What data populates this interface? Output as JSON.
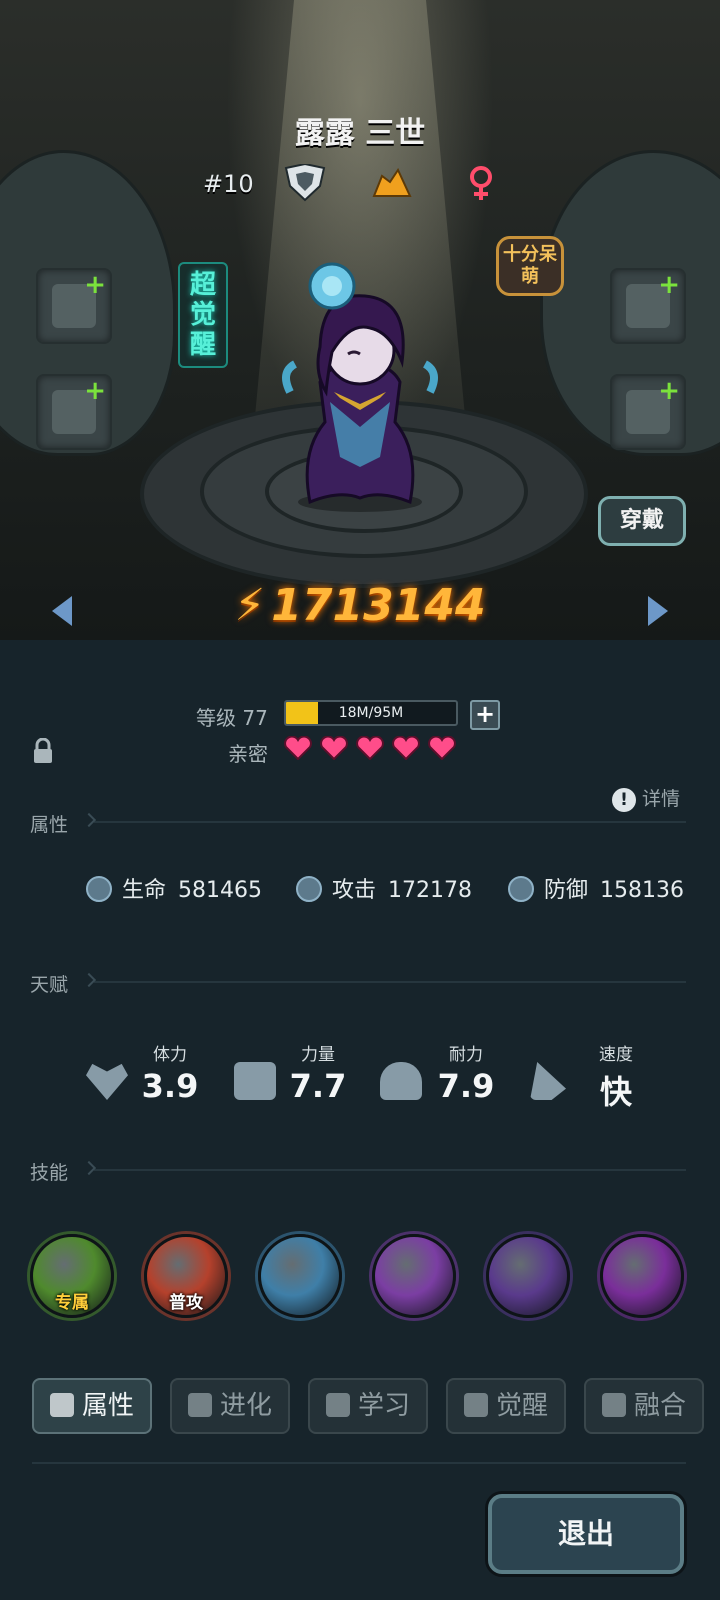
{
  "hero": {
    "name": "露露 三世",
    "rank": "#10",
    "awaken_badge": "超觉醒",
    "trait_badge": "十分呆萌",
    "equip_button": "穿戴",
    "power": "1713144"
  },
  "progress": {
    "level_label": "等级 77",
    "exp_text": "18M/95M",
    "exp_fraction": 0.19,
    "intimacy_label": "亲密",
    "hearts": 5
  },
  "sections": {
    "attributes": "属性",
    "details": "详情",
    "talent": "天赋",
    "skills": "技能"
  },
  "stats": [
    {
      "label": "生命",
      "value": "581465",
      "icon": "heart-shield-icon"
    },
    {
      "label": "攻击",
      "value": "172178",
      "icon": "sword-icon"
    },
    {
      "label": "防御",
      "value": "158136",
      "icon": "shield-icon"
    }
  ],
  "talents": [
    {
      "label": "体力",
      "value": "3.9",
      "icon": "heart-icon"
    },
    {
      "label": "力量",
      "value": "7.7",
      "icon": "fist-icon"
    },
    {
      "label": "耐力",
      "value": "7.9",
      "icon": "muscle-icon"
    },
    {
      "label": "速度",
      "value": "快",
      "icon": "wing-icon"
    }
  ],
  "skills": [
    {
      "tag": "专属",
      "color": "#4f8a2d"
    },
    {
      "tag": "普攻",
      "color": "#b5412c"
    },
    {
      "tag": "",
      "color": "#3f7fa8"
    },
    {
      "tag": "",
      "color": "#7b3ea3"
    },
    {
      "tag": "",
      "color": "#5a3a8c"
    },
    {
      "tag": "",
      "color": "#7a2e9a"
    }
  ],
  "tabs": [
    {
      "label": "属性",
      "active": true
    },
    {
      "label": "进化",
      "active": false
    },
    {
      "label": "学习",
      "active": false
    },
    {
      "label": "觉醒",
      "active": false
    },
    {
      "label": "融合",
      "active": false
    }
  ],
  "exit_button": "退出",
  "colors": {
    "power": "#ffb63a",
    "heart": "#ff4d8a",
    "exp_fill": "#f2c318",
    "plus": "#7be23c",
    "awaken": "#57f0d8"
  }
}
